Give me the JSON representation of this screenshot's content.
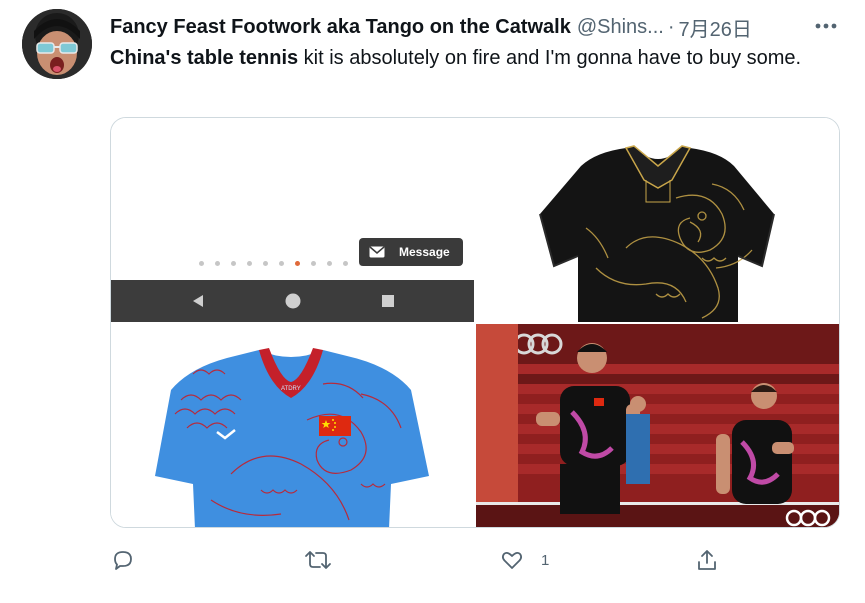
{
  "author": {
    "display_name": "Fancy Feast Footwork aka Tango on the Catwalk",
    "handle": "@Shins...",
    "separator": "·",
    "timestamp": "7月26日"
  },
  "tweet": {
    "text_bold": "China's table tennis",
    "text_rest": " kit is absolutely on fire and I'm gonna have to buy some."
  },
  "media": {
    "images": [
      {
        "name": "phone-screenshot",
        "message_button": "Message",
        "carousel_dots": 11,
        "active_dot": 6
      },
      {
        "name": "black-dragon-jersey"
      },
      {
        "name": "blue-dragon-jersey",
        "collar_brand": "ATDRY"
      },
      {
        "name": "players-photo"
      }
    ]
  },
  "actions": {
    "reply_count": "",
    "retweet_count": "",
    "like_count": "1",
    "share_count": ""
  },
  "colors": {
    "text": "#0f1419",
    "muted": "#536471",
    "border": "#cfd9de"
  }
}
